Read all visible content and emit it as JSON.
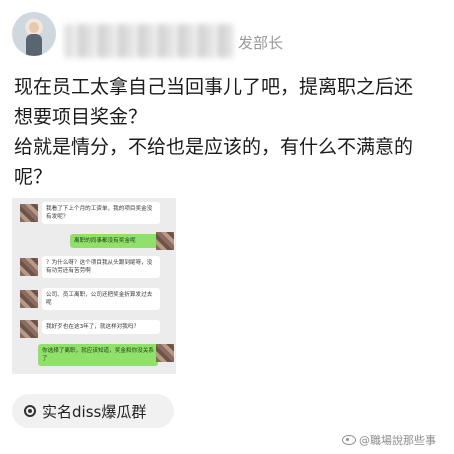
{
  "header": {
    "author_name_suffix": "发部长"
  },
  "post": {
    "lines": [
      "现在员工太拿自己当回事儿了吧，提离职之后还",
      "想要项目奖金？",
      "给就是情分，不给也是应该的，有什么不满意的",
      "呢？"
    ]
  },
  "chat_image": {
    "messages": [
      {
        "side": "in",
        "text": "我看了下上个月的工资单，我的项目奖金没有发呢？"
      },
      {
        "side": "out",
        "text": "离职的同事都没有奖金呢"
      },
      {
        "side": "in",
        "text": "？为什么呀？这个项目我从头跟到尾呀，没有功劳还有苦劳啊"
      },
      {
        "side": "in",
        "text": "公司、员工离职，公司还把奖金折算发过去呢"
      },
      {
        "side": "in",
        "text": "我好歹也在这3年了，就这样对我吗？"
      },
      {
        "side": "out",
        "text": "你选择了离职，就应该知道，奖金和你没关系了"
      }
    ]
  },
  "tag": {
    "label": "实名diss爆瓜群",
    "icon": "target-icon"
  },
  "watermark": {
    "text": "@職場說那些事"
  }
}
